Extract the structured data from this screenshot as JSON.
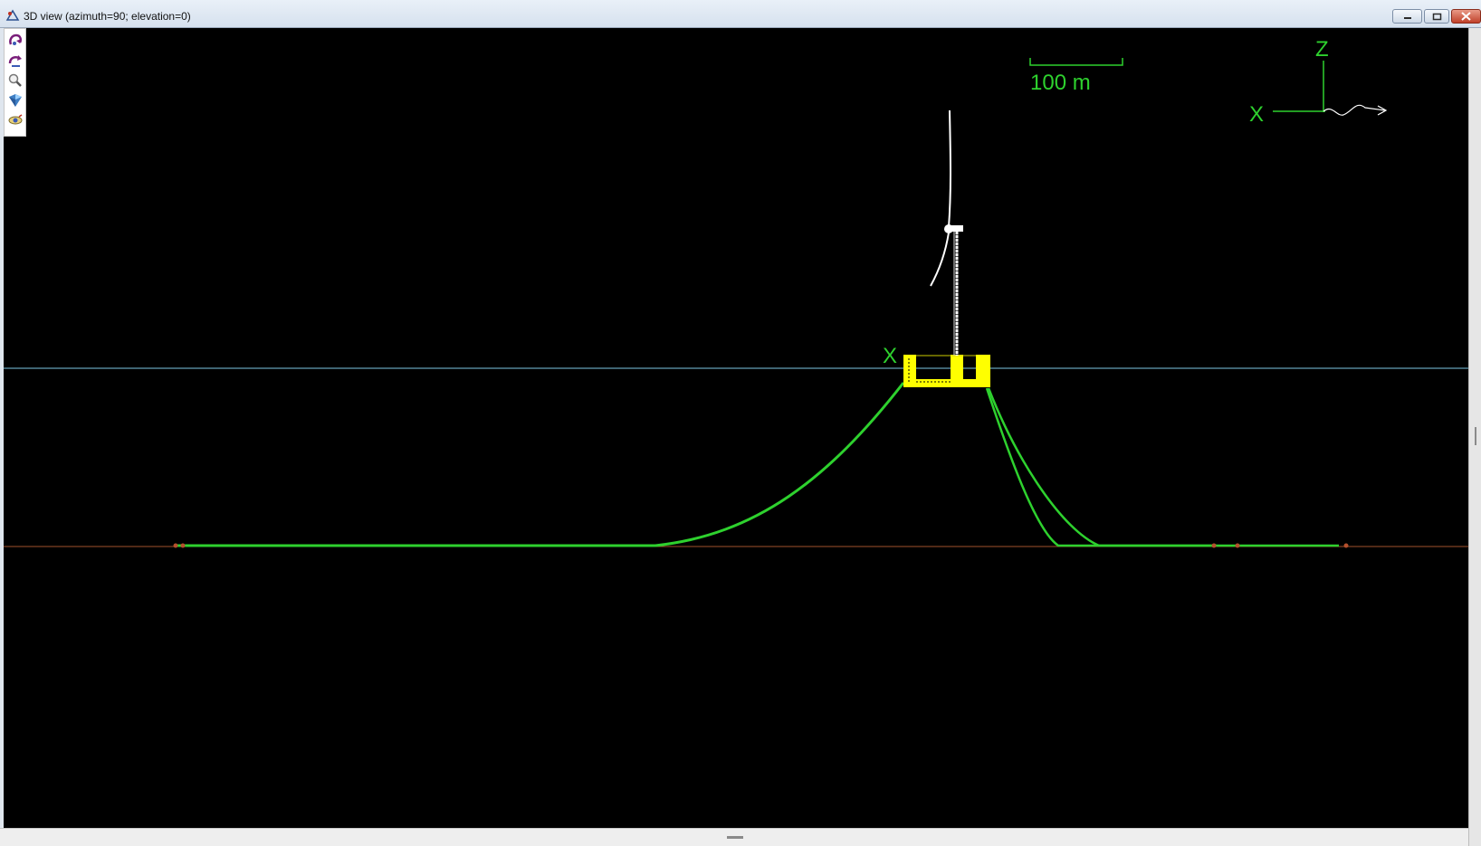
{
  "window": {
    "title": "3D view (azimuth=90; elevation=0)",
    "app_icon": "orcaflex-app-icon",
    "controls": [
      "minimize-icon",
      "maximize-icon",
      "close-icon"
    ]
  },
  "toolbar": {
    "tools": [
      {
        "name": "rotate-tool-icon"
      },
      {
        "name": "pan-tool-icon"
      },
      {
        "name": "zoom-tool-icon"
      },
      {
        "name": "view-shaded-tool-icon"
      },
      {
        "name": "view-options-tool-icon"
      }
    ]
  },
  "view": {
    "azimuth": 90,
    "elevation": 0,
    "scale_bar_label": "100 m",
    "axis_labels": {
      "z": "Z",
      "x": "X"
    },
    "vessel_axis_label": "X",
    "colors": {
      "background": "#000000",
      "lines": "#2ed12e",
      "sea_surface": "#7ec8e3",
      "seabed": "#a0522d",
      "vessel": "#ffff00",
      "turbine": "#ffffff",
      "anchors": "#b5502d"
    }
  }
}
